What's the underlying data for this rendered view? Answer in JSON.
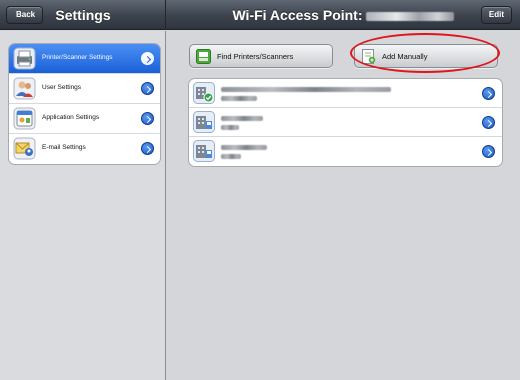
{
  "navbar": {
    "back_label": "Back",
    "left_title": "Settings",
    "right_title": "Wi-Fi Access Point:",
    "edit_label": "Edit"
  },
  "sidebar": {
    "items": [
      {
        "label": "Printer/Scanner Settings",
        "icon": "printer-scanner-icon",
        "selected": true
      },
      {
        "label": "User Settings",
        "icon": "users-icon",
        "selected": false
      },
      {
        "label": "Application Settings",
        "icon": "application-icon",
        "selected": false
      },
      {
        "label": "E-mail Settings",
        "icon": "email-icon",
        "selected": false
      }
    ]
  },
  "main": {
    "find_button_label": "Find Printers/Scanners",
    "add_button_label": "Add Manually",
    "devices": [
      {
        "icon": "printer-connected-icon",
        "status": "connected"
      },
      {
        "icon": "printer-icon",
        "status": "available"
      },
      {
        "icon": "printer-icon",
        "status": "available"
      }
    ]
  },
  "colors": {
    "selected_accent": "#1a61d9",
    "highlight": "#e0141c",
    "navbar": "#3c434d"
  }
}
